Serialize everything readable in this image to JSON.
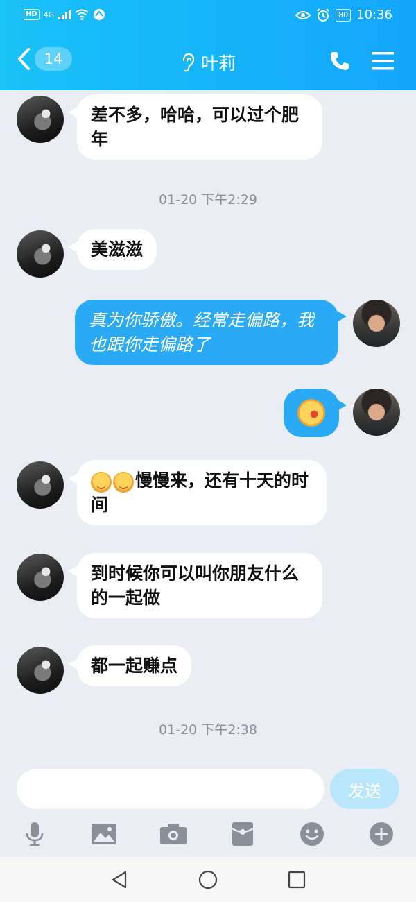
{
  "status_bar": {
    "hd": "HD",
    "network": "4G",
    "battery": "80",
    "time": "10:36"
  },
  "nav": {
    "unread_count": "14",
    "contact_name": "叶莉"
  },
  "messages": [
    {
      "side": "left",
      "text": "差不多，哈哈，可以过个肥年"
    },
    {
      "type": "time",
      "text": "01-20 下午2:29"
    },
    {
      "side": "left",
      "text": "美滋滋"
    },
    {
      "side": "right",
      "text": "真为你骄傲。经常走偏路，我也跟你走偏路了"
    },
    {
      "side": "right",
      "emoji": "laughing-tongue-emoji"
    },
    {
      "side": "left",
      "emoji_prefix": [
        "yawn-emoji",
        "yawn-emoji"
      ],
      "text": "慢慢来，还有十天的时间"
    },
    {
      "side": "left",
      "text": "到时候你可以叫你朋友什么的一起做"
    },
    {
      "side": "left",
      "text": "都一起赚点"
    },
    {
      "type": "time",
      "text": "01-20 下午2:38"
    }
  ],
  "input": {
    "placeholder": "",
    "send_label": "发送"
  },
  "toolbar": [
    "microphone-icon",
    "image-icon",
    "camera-icon",
    "red-packet-icon",
    "emoji-icon",
    "plus-icon"
  ],
  "colors": {
    "header_start": "#19c2f7",
    "header_end": "#13a6fb",
    "bubble_out": "#2aaaf5",
    "bubble_in": "#ffffff",
    "background": "#eaedf4"
  }
}
